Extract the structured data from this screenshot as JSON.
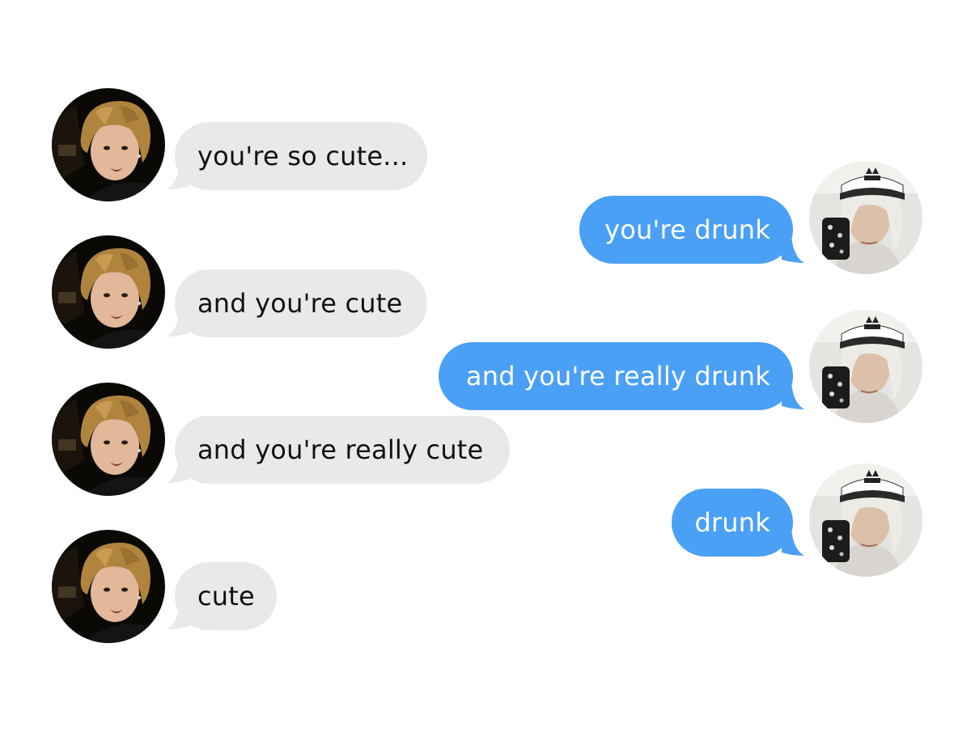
{
  "colors": {
    "received_bubble": "#e9e9eb",
    "sent_bubble": "#4aa0f5",
    "received_text": "#111111",
    "sent_text": "#ffffff"
  },
  "messages": [
    {
      "sender": "left",
      "text": "you're so cute..."
    },
    {
      "sender": "right",
      "text": "you're drunk"
    },
    {
      "sender": "left",
      "text": "and you're cute"
    },
    {
      "sender": "right",
      "text": "and you're really drunk"
    },
    {
      "sender": "left",
      "text": "and you're really cute"
    },
    {
      "sender": "right",
      "text": "drunk"
    },
    {
      "sender": "left",
      "text": "cute"
    }
  ]
}
